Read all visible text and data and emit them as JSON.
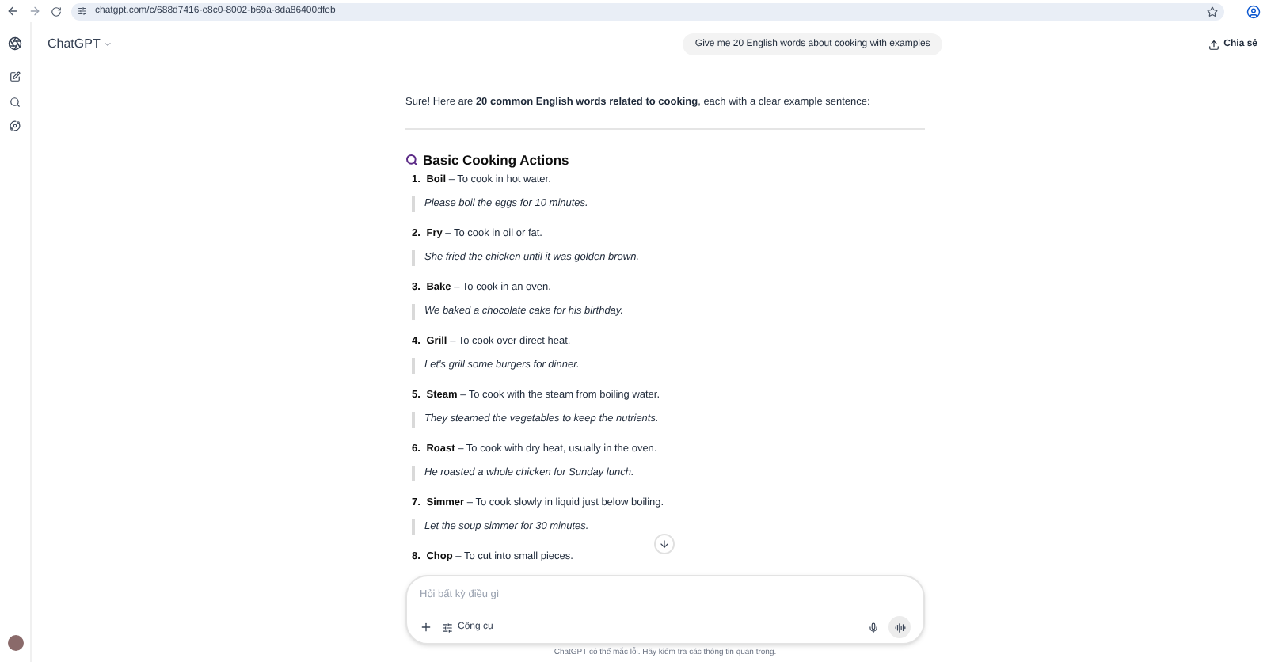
{
  "browser": {
    "url": "chatgpt.com/c/688d7416-e8c0-8002-b69a-8da86400dfeb"
  },
  "header": {
    "model": "ChatGPT",
    "share": "Chia sẻ"
  },
  "user_message": "Give me 20 English words about cooking with examples",
  "answer": {
    "intro": "Sure! Here are **20 common English words related to cooking**, each with a clear example sentence:",
    "section_title": "Basic Cooking Actions",
    "items": [
      {
        "number": "1.",
        "term": "Boil",
        "definition": "– To cook in hot water.",
        "example": "Please boil the eggs for 10 minutes."
      },
      {
        "number": "2.",
        "term": "Fry",
        "definition": "– To cook in oil or fat.",
        "example": "She fried the chicken until it was golden brown."
      },
      {
        "number": "3.",
        "term": "Bake",
        "definition": "– To cook in an oven.",
        "example": "We baked a chocolate cake for his birthday."
      },
      {
        "number": "4.",
        "term": "Grill",
        "definition": "– To cook over direct heat.",
        "example": "Let's grill some burgers for dinner."
      },
      {
        "number": "5.",
        "term": "Steam",
        "definition": "– To cook with the steam from boiling water.",
        "example": "They steamed the vegetables to keep the nutrients."
      },
      {
        "number": "6.",
        "term": "Roast",
        "definition": "– To cook with dry heat, usually in the oven.",
        "example": "He roasted a whole chicken for Sunday lunch."
      },
      {
        "number": "7.",
        "term": "Simmer",
        "definition": "– To cook slowly in liquid just below boiling.",
        "example": "Let the soup simmer for 30 minutes."
      },
      {
        "number": "8.",
        "term": "Chop",
        "definition": "– To cut into small pieces."
      }
    ]
  },
  "composer": {
    "placeholder": "Hỏi bất kỳ điều gì",
    "tools": "Công cụ"
  },
  "footer": "ChatGPT có thể mắc lỗi. Hãy kiểm tra các thông tin quan trọng."
}
